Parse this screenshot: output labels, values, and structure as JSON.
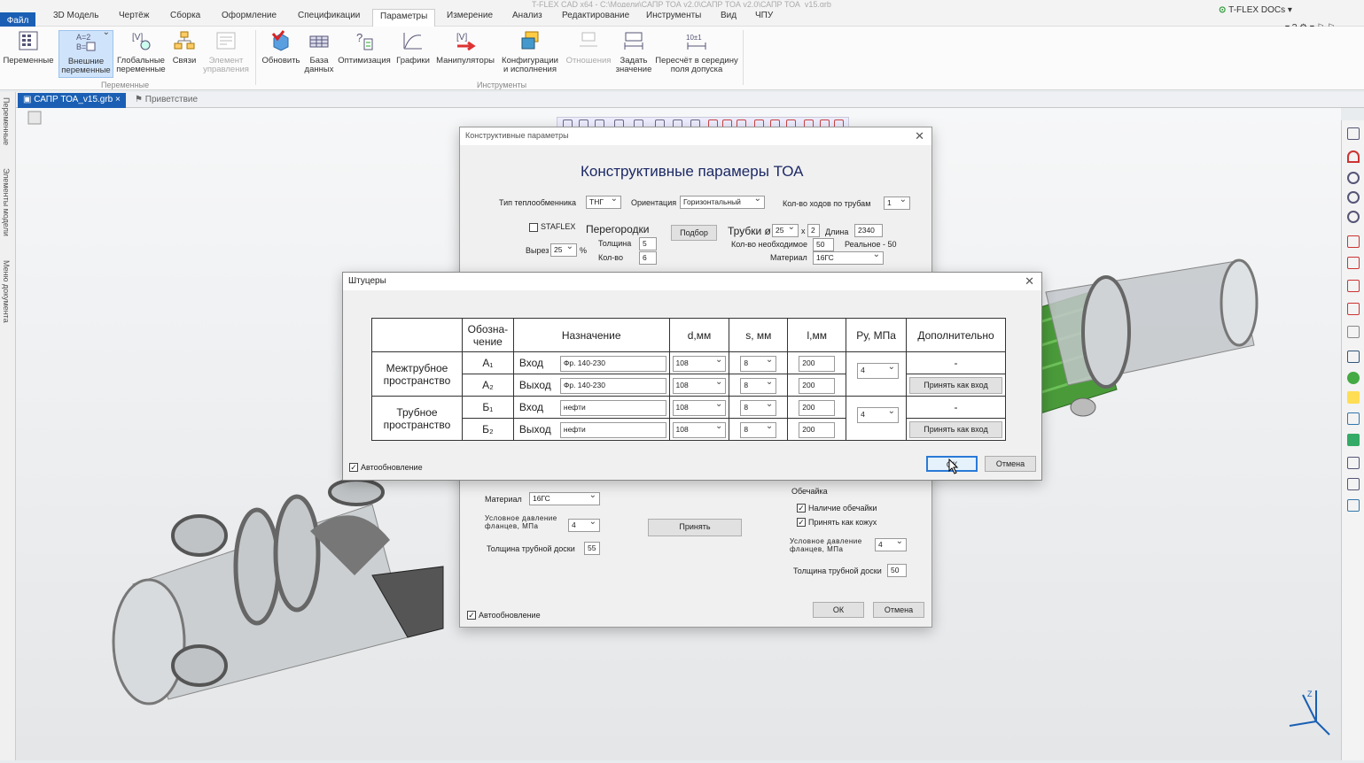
{
  "app": {
    "title": "T-FLEX CAD x64 - C:\\Модели\\САПР ТОА v2.0\\САПР ТОА v2.0\\САПР ТОА_v15.grb",
    "brand": "T-FLEX DOCs",
    "window_controls": "▾ ? ⚙ ▾ ⚐ ⚐"
  },
  "menu": [
    "Файл",
    "3D Модель",
    "Чертёж",
    "Сборка",
    "Оформление",
    "Спецификации",
    "Параметры",
    "Измерение",
    "Анализ",
    "Редактирование",
    "Инструменты",
    "Вид",
    "ЧПУ"
  ],
  "ribbon": {
    "buttons": [
      {
        "label": "Переменные",
        "icon": "variables-icon"
      },
      {
        "label": "Внешние переменные",
        "icon": "external-variables-icon"
      },
      {
        "label": "Глобальные переменные",
        "icon": "global-variables-icon"
      },
      {
        "label": "Связи",
        "icon": "links-icon"
      },
      {
        "label": "Элемент управления",
        "icon": "control-element-icon"
      },
      {
        "label": "Обновить",
        "icon": "refresh-icon"
      },
      {
        "label": "База данных",
        "icon": "database-icon"
      },
      {
        "label": "Оптимизация",
        "icon": "optimization-icon"
      },
      {
        "label": "Графики",
        "icon": "graphs-icon"
      },
      {
        "label": "Манипуляторы",
        "icon": "manipulators-icon"
      },
      {
        "label": "Конфигурации и исполнения",
        "icon": "configurations-icon"
      },
      {
        "label": "Отношения",
        "icon": "relations-icon"
      },
      {
        "label": "Задать значение",
        "icon": "set-value-icon"
      },
      {
        "label": "Пересчёт в середину поля допуска",
        "icon": "tolerance-middle-icon"
      }
    ],
    "group_variables": "Переменные",
    "group_tools": "Инструменты"
  },
  "doc_tabs": {
    "active": "САПР ТОА_v15.grb",
    "other": "Приветствие"
  },
  "left_panel": [
    "Переменные",
    "Элементы модели",
    "Меню документа"
  ],
  "dialog_back": {
    "title": "Конструктивные параметры",
    "heading": "Конструктивные парамеры ТОА",
    "type_label": "Тип теплообменника",
    "type_value": "ТНГ",
    "orient_label": "Ориентация",
    "orient_value": "Горизонтальный",
    "passes_label": "Кол-во ходов по трубам",
    "passes_value": "1",
    "staflex": "STAFLEX",
    "baffles": "Перегородки",
    "thickness_label": "Толщина",
    "thickness_value": "5",
    "count_label": "Кол-во",
    "count_value": "6",
    "cut_label": "Вырез",
    "cut_value": "25",
    "cut_unit": "%",
    "pick_button": "Подбор",
    "tubes": "Трубки ø",
    "tube_d": "25",
    "tube_x": "x",
    "tube_s": "2",
    "length_label": "Длина",
    "length_value": "2340",
    "needed_label": "Кол-во необходимое",
    "needed_value": "50",
    "real_label": "Реальное - 50",
    "material_label": "Материал",
    "material_value": "16ГС",
    "material2_value": "16ГС",
    "pressure_label": "Условное давление фланцев, МПа",
    "pressure_value": "4",
    "sheet_label": "Толщина трубной доски",
    "sheet_value": "55",
    "accept_button": "Принять",
    "shell_group": "Обечайка",
    "shell_present": "Наличие обечайки",
    "shell_as_casing": "Принять как кожух",
    "pressure2_value": "4",
    "sheet2_value": "50",
    "autoupdate": "Автообновление",
    "ok": "ОК",
    "cancel": "Отмена"
  },
  "dialog_front": {
    "title": "Штуцеры",
    "headers": [
      "Обозна-чение",
      "Назначение",
      "d,мм",
      "s, мм",
      "l,мм",
      "Ру, МПа",
      "Дополнительно"
    ],
    "groups": [
      {
        "name": "Межтрубное пространство",
        "pressure": "4",
        "rows": [
          {
            "code": "A₁",
            "purpose": "Вход",
            "text": "Фр. 140-230",
            "d": "108",
            "s": "8",
            "l": "200",
            "extra": "-",
            "extra_is_button": false
          },
          {
            "code": "A₂",
            "purpose": "Выход",
            "text": "Фр. 140-230",
            "d": "108",
            "s": "8",
            "l": "200",
            "extra": "Принять как вход",
            "extra_is_button": true
          }
        ]
      },
      {
        "name": "Трубное пространство",
        "pressure": "4",
        "rows": [
          {
            "code": "Б₁",
            "purpose": "Вход",
            "text": "нефти",
            "d": "108",
            "s": "8",
            "l": "200",
            "extra": "-",
            "extra_is_button": false
          },
          {
            "code": "Б₂",
            "purpose": "Выход",
            "text": "нефти",
            "d": "108",
            "s": "8",
            "l": "200",
            "extra": "Принять как вход",
            "extra_is_button": true
          }
        ]
      }
    ],
    "autoupdate": "Автообновление",
    "ok": "ОК",
    "cancel": "Отмена"
  }
}
